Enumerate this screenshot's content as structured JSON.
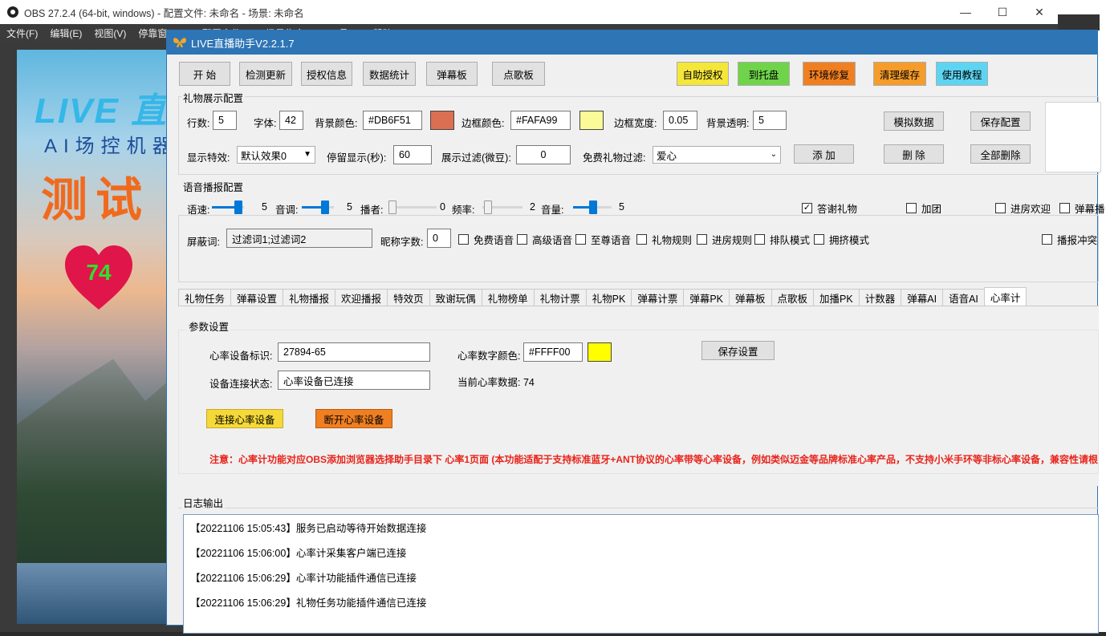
{
  "obs": {
    "title": "OBS 27.2.4 (64-bit, windows) - 配置文件: 未命名 - 场景: 未命名",
    "menu": [
      "文件(F)",
      "编辑(E)",
      "视图(V)",
      "停靠窗口(D)",
      "配置文件(P)",
      "场景集合(S)",
      "工具(T)",
      "帮助(H)"
    ],
    "win_min": "—",
    "win_max": "☐",
    "win_close": "✕"
  },
  "preview": {
    "live_text": "LIVE 直播",
    "ai_text": "AI场控机器人",
    "test_text": "测试",
    "heart_value": "74"
  },
  "app": {
    "title": "LIVE直播助手V2.2.1.7",
    "toolbar": {
      "start": "开 始",
      "check_update": "检测更新",
      "auth_info": "授权信息",
      "data_stats": "数据统计",
      "danmu_board": "弹幕板",
      "song_board": "点歌板",
      "self_auth": "自助授权",
      "to_tray": "到托盘",
      "env_repair": "环境修复",
      "clear_cache": "清理缓存",
      "tutorial": "使用教程"
    },
    "colors": {
      "self_auth": "#f5e63a",
      "to_tray": "#6fd44a",
      "env_repair": "#f07f22",
      "clear_cache": "#f59c2a",
      "tutorial": "#5dd5f2",
      "bg_color": "#DB6F51",
      "border_color": "#FAFA99",
      "hr_color": "#FFFF00"
    },
    "gift_cfg": {
      "group": "礼物展示配置",
      "rows_label": "行数:",
      "rows_value": "5",
      "font_label": "字体:",
      "font_value": "42",
      "bg_label": "背景颜色:",
      "bg_value": "#DB6F51",
      "border_label": "边框颜色:",
      "border_value": "#FAFA99",
      "border_width_label": "边框宽度:",
      "border_width_value": "0.05",
      "bg_opacity_label": "背景透明:",
      "bg_opacity_value": "5",
      "mock_data": "模拟数据",
      "save_config": "保存配置",
      "effect_label": "显示特效:",
      "effect_value": "默认效果0",
      "stay_label": "停留显示(秒):",
      "stay_value": "60",
      "filter_label": "展示过滤(微豆):",
      "filter_value": "0",
      "free_filter_label": "免费礼物过滤:",
      "free_filter_value": "爱心",
      "add": "添 加",
      "delete": "删 除",
      "delete_all": "全部删除"
    },
    "voice_cfg": {
      "group": "语音播报配置",
      "speed_label": "语速:",
      "speed_value": "5",
      "pitch_label": "音调:",
      "pitch_value": "5",
      "speaker_label": "播者:",
      "speaker_value": "0",
      "rate_label": "频率:",
      "rate_value": "2",
      "volume_label": "音量:",
      "volume_value": "5",
      "thank_gift": "答谢礼物",
      "join_group": "加团",
      "welcome": "进房欢迎",
      "danmu": "弹幕播",
      "block_label": "屏蔽词:",
      "block_value": "过滤词1;过滤词2",
      "nick_len_label": "昵称字数:",
      "nick_len_value": "0",
      "free_voice": "免费语音",
      "adv_voice": "高级语音",
      "vip_voice": "至尊语音",
      "gift_rule": "礼物规则",
      "enter_rule": "进房规则",
      "queue_mode": "排队模式",
      "crowd_mode": "拥挤模式",
      "report_conflict": "播报冲突"
    },
    "tabs": [
      "礼物任务",
      "弹幕设置",
      "礼物播报",
      "欢迎播报",
      "特效页",
      "致谢玩偶",
      "礼物榜单",
      "礼物计票",
      "礼物PK",
      "弹幕计票",
      "弹幕PK",
      "弹幕板",
      "点歌板",
      "加播PK",
      "计数器",
      "弹幕AI",
      "语音AI",
      "心率计"
    ],
    "heart": {
      "group": "参数设置",
      "device_id_label": "心率设备标识:",
      "device_id_value": "27894-65",
      "color_label": "心率数字颜色:",
      "color_value": "#FFFF00",
      "save": "保存设置",
      "status_label": "设备连接状态:",
      "status_value": "心率设备已连接",
      "current_label": "当前心率数据: 74",
      "connect": "连接心率设备",
      "disconnect": "断开心率设备",
      "notice": "注意：心率计功能对应OBS添加浏览器选择助手目录下 心率1页面 (本功能适配于支持标准蓝牙+ANT协议的心率带等心率设备，例如类似迈金等品牌标准心率产品，不支持小米手环等非标心率设备，兼容性请根"
    },
    "log": {
      "label": "日志输出",
      "lines": [
        "【20221106 15:05:43】服务已启动等待开始数据连接",
        "【20221106 15:06:00】心率计采集客户端已连接",
        "【20221106 15:06:29】心率计功能插件通信已连接",
        "【20221106 15:06:29】礼物任务功能插件通信已连接"
      ]
    }
  }
}
